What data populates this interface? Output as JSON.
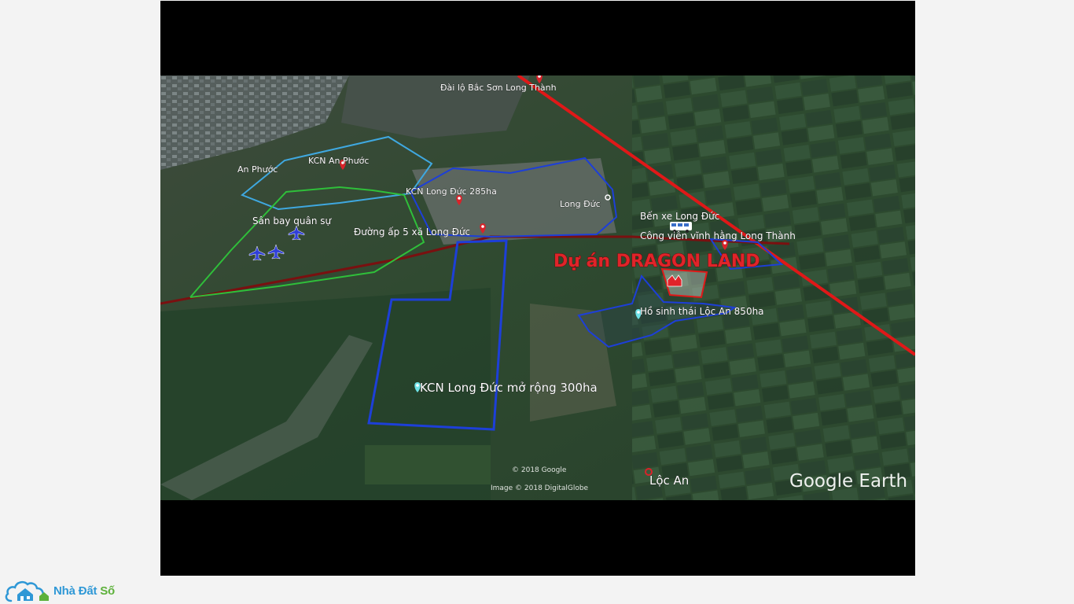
{
  "map": {
    "labels": {
      "an_phuoc": "An Phước",
      "kcn_an_phuoc": "KCN An Phước",
      "kcn_long_duc_285": "KCN Long Đức 285ha",
      "long_duc": "Long Đức",
      "ben_xe": "Bến xe Long Đức",
      "cong_vien": "Công viên vĩnh hằng Long Thành",
      "san_bay": "Sân bay quân sự",
      "duong_ap5": "Đường ấp 5 xã Long Đức",
      "dragon_land": "Dự án DRAGON LAND",
      "ho_sinh_thai": "Hồ sinh thái Lộc An 850ha",
      "kcn_mo_rong": "KCN Long Đức mở rộng 300ha",
      "loc_an": "Lộc An",
      "top_label": "Đài lộ Bắc Sơn Long Thành"
    },
    "credits": {
      "google_copyright": "© 2018 Google",
      "imagery": "Image © 2018 DigitalGlobe"
    },
    "logo_text": "Google Earth",
    "colors": {
      "boundary_light_blue": "#3fa8e0",
      "boundary_green": "#2fbf3a",
      "boundary_blue": "#1d3fd8",
      "highway_red": "#e01818",
      "road_dark_red": "#7a1010",
      "dragon_red": "#e0242a"
    }
  },
  "brand": {
    "name_part1": "Nhà Đất",
    "name_part2": "Số"
  }
}
